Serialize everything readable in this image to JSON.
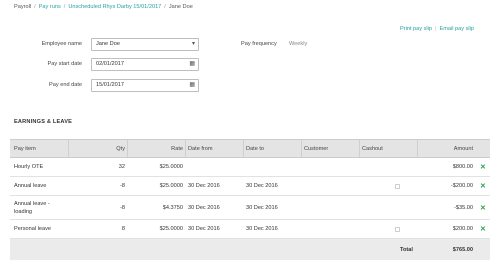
{
  "breadcrumb": {
    "items": [
      {
        "label": "Payroll",
        "link": false
      },
      {
        "label": "Pay runs",
        "link": true
      },
      {
        "label": "Unscheduled Rhys Darby 15/01/2017",
        "link": true
      },
      {
        "label": "Jane Doe",
        "link": false
      }
    ],
    "separator": "/"
  },
  "actions": {
    "print_pay_slip": "Print pay slip",
    "email_pay_slip": "Email pay slip",
    "separator": "|"
  },
  "form": {
    "employee_name_label": "Employee name",
    "employee_name_value": "Jane Doe",
    "pay_start_date_label": "Pay start date",
    "pay_start_date_value": "02/01/2017",
    "pay_end_date_label": "Pay end date",
    "pay_end_date_value": "15/01/2017",
    "pay_frequency_label": "Pay frequency",
    "pay_frequency_value": "Weekly"
  },
  "section": {
    "title": "EARNINGS & LEAVE"
  },
  "table": {
    "headers": {
      "pay_item": "Pay item",
      "qty": "Qty",
      "rate": "Rate",
      "date_from": "Date from",
      "date_to": "Date to",
      "customer": "Customer",
      "cashout": "Cashout",
      "amount": "Amount"
    },
    "rows": [
      {
        "pay_item": "Hourly OTE",
        "qty": "32",
        "rate": "$25.0000",
        "date_from": "",
        "date_to": "",
        "customer": "",
        "cashout": false,
        "amount": "$800.00"
      },
      {
        "pay_item": "Annual leave",
        "qty": "-8",
        "rate": "$25.0000",
        "date_from": "30 Dec 2016",
        "date_to": "30 Dec 2016",
        "customer": "",
        "cashout": true,
        "amount": "-$200.00"
      },
      {
        "pay_item": "Annual leave -\nloading",
        "qty": "-8",
        "rate": "$4.3750",
        "date_from": "30 Dec 2016",
        "date_to": "30 Dec 2016",
        "customer": "",
        "cashout": false,
        "amount": "-$35.00"
      },
      {
        "pay_item": "Personal leave",
        "qty": "8",
        "rate": "$25.0000",
        "date_from": "30 Dec 2016",
        "date_to": "30 Dec 2016",
        "customer": "",
        "cashout": true,
        "amount": "$200.00"
      }
    ],
    "remove_symbol": "✕",
    "total_label": "Total",
    "total_value": "$765.00"
  },
  "icons": {
    "dropdown": "▾",
    "calendar": "▦"
  },
  "colors": {
    "link": "#2aa0a4",
    "remove": "#2aa04a",
    "header_bg": "#e4e4e4"
  }
}
